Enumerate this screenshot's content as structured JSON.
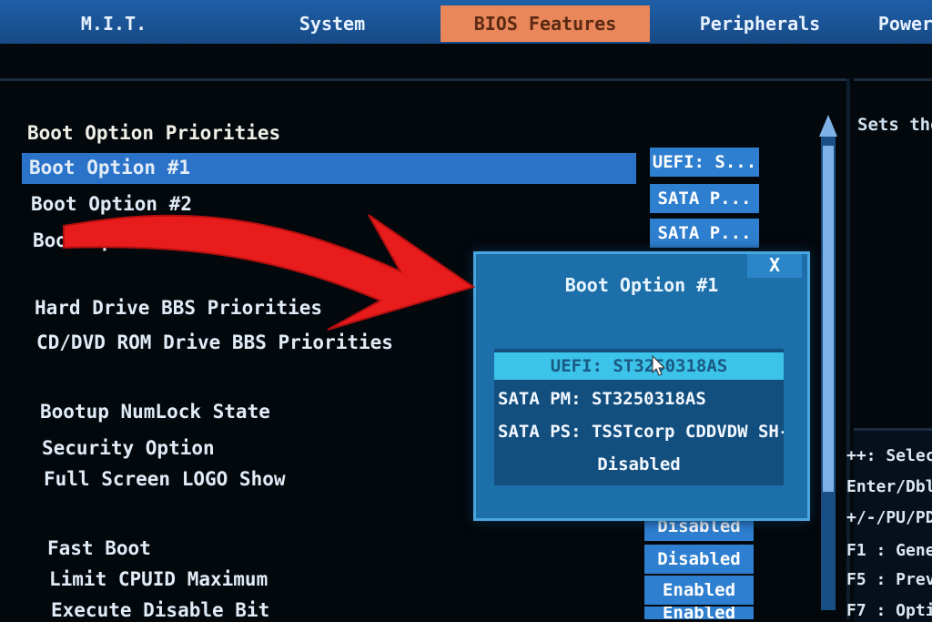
{
  "tabs": [
    "M.I.T.",
    "System",
    "BIOS Features",
    "Peripherals",
    "Power"
  ],
  "active_tab_index": 2,
  "items": {
    "boot_priorities": "Boot Option Priorities",
    "boot1": "Boot Option #1",
    "boot2": "Boot Option #2",
    "boot3": "Boot Option #3",
    "hdd_bbs": "Hard Drive BBS Priorities",
    "cd_bbs": "CD/DVD ROM Drive BBS Priorities",
    "numlock": "Bootup NumLock State",
    "security": "Security Option",
    "fullscreen_logo": "Full Screen LOGO Show",
    "fast_boot": "Fast Boot",
    "limit_cpuid": "Limit CPUID Maximum",
    "execute_disable": "Execute Disable Bit"
  },
  "values": {
    "boot1": "UEFI: S...",
    "boot2": "SATA  P...",
    "boot3": "SATA  P...",
    "v1": "Disabled",
    "v2": "Disabled",
    "v3": "Enabled",
    "v4": "Enabled"
  },
  "help": {
    "text": "Sets the",
    "keys": [
      "++: Select",
      "Enter/Dbl",
      "+/-/PU/PD:",
      "F1  : Gene",
      "F5  : Prev",
      "F7  : Opti"
    ]
  },
  "popup": {
    "title": "Boot Option #1",
    "close": "X",
    "options": [
      "UEFI: ST3250318AS",
      "SATA  PM: ST3250318AS",
      "SATA  PS: TSSTcorp CDDVDW SH-S",
      "Disabled"
    ],
    "selected_index": 0
  },
  "colors": {
    "arrow": "#e81c1c",
    "active_tab": "#e9865a",
    "selection": "#2b73c9",
    "popup": "#1d6faa"
  }
}
